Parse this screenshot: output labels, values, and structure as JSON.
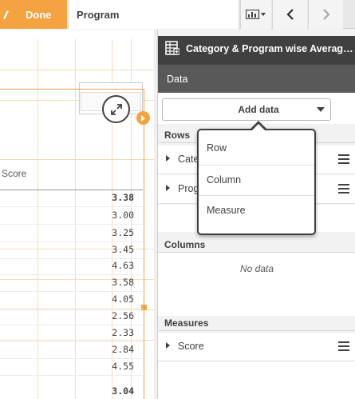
{
  "toolbar": {
    "done_label": "Done",
    "sheet_title": "Program"
  },
  "table": {
    "column_header": "Score",
    "rows": [
      {
        "value": "3.38",
        "total": true
      },
      {
        "value": "3.00",
        "total": false
      },
      {
        "value": "3.25",
        "total": false
      },
      {
        "value": "3.45",
        "total": false
      },
      {
        "value": "4.63",
        "total": false
      },
      {
        "value": "3.58",
        "total": false
      },
      {
        "value": "4.05",
        "total": false
      },
      {
        "value": "2.56",
        "total": false
      },
      {
        "value": "2.33",
        "total": false
      },
      {
        "value": "2.84",
        "total": false
      },
      {
        "value": "4.55",
        "total": false
      },
      {
        "value": "3.04",
        "total": true
      }
    ]
  },
  "panel": {
    "title": "Category & Program wise Average Score",
    "data_tab": "Data",
    "add_data_label": "Add data",
    "rows_section": "Rows",
    "rows_fields": [
      "Category",
      "Program"
    ],
    "columns_section": "Columns",
    "columns_empty": "No data",
    "measures_section": "Measures",
    "measures_fields": [
      "Score"
    ]
  },
  "dropdown": {
    "items": [
      "Row",
      "Column",
      "Measure"
    ]
  },
  "colors": {
    "accent": "#f5a340",
    "panel_header": "#404040",
    "data_tab": "#595959"
  }
}
